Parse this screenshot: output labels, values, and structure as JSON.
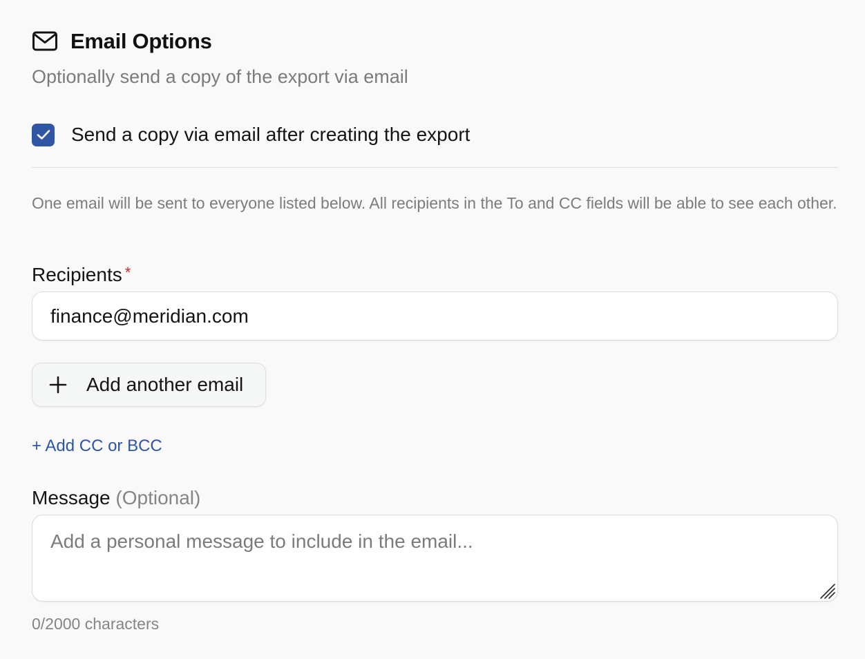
{
  "section": {
    "title": "Email Options",
    "subtitle": "Optionally send a copy of the export via email",
    "icon": "mail-icon"
  },
  "send_copy": {
    "label": "Send a copy via email after creating the export",
    "checked": true
  },
  "notice": "One email will be sent to everyone listed below. All recipients in the To and CC fields will be able to see each other.",
  "recipients": {
    "label": "Recipients",
    "required_mark": "*",
    "value": "finance@meridian.com"
  },
  "add_email": {
    "label": "Add another email",
    "icon": "plus-icon"
  },
  "cc_link": "+ Add CC or BCC",
  "message": {
    "label": "Message",
    "optional": "(Optional)",
    "placeholder": "Add a personal message to include in the email...",
    "char_count": "0/2000 characters"
  },
  "colors": {
    "accent": "#2f55a4",
    "required": "#c62828",
    "muted_text": "#7b7b7b"
  }
}
